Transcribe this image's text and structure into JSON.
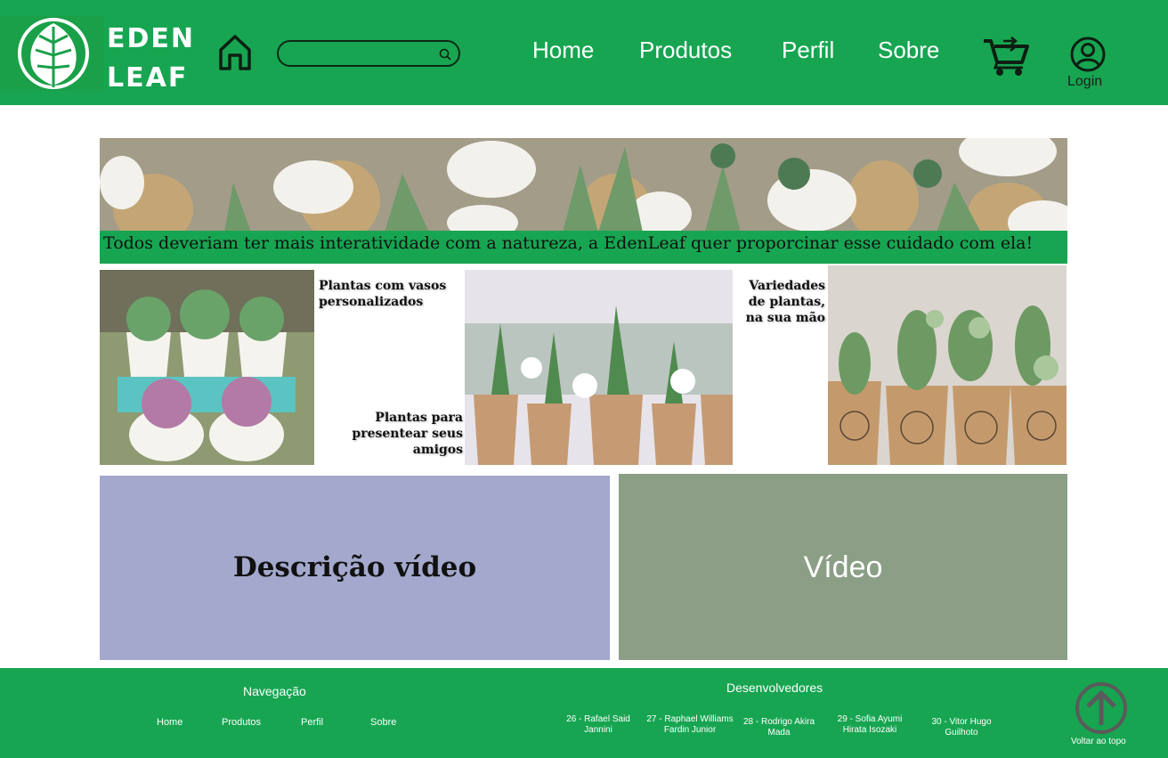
{
  "header": {
    "brand_line1": "EDEN",
    "brand_line2": "LEAF",
    "search": {
      "placeholder": "",
      "value": ""
    },
    "nav": [
      "Home",
      "Produtos",
      "Perfil",
      "Sobre"
    ],
    "login_label": "Login",
    "icons": [
      "leaf-logo",
      "home-icon",
      "search-icon",
      "cart-icon",
      "user-icon"
    ]
  },
  "banner": {
    "image": "succulents-with-cultive-o-amor-tags",
    "caption": "Todos deveriam ter mais interatividade com a natureza, a EdenLeaf quer proporcinar esse cuidado com ela!"
  },
  "gallery": {
    "caption1": "Plantas com vasos personalizados",
    "caption2": "Plantas para presentear seus amigos",
    "caption3": "Variedades de plantas, na sua mão"
  },
  "video_section": {
    "description_title": "Descrição vídeo",
    "video_label": "Vídeo"
  },
  "footer": {
    "nav_heading": "Navegação",
    "nav": [
      "Home",
      "Produtos",
      "Perfil",
      "Sobre"
    ],
    "dev_heading": "Desenvolvedores",
    "developers": [
      "26 - Rafael Said Jannini",
      "27 - Raphael Williams Fardin Junior",
      "28 - Rodrigo Akira Mada",
      "29 - Sofia Ayumi Hirata Isozaki",
      "30 - Vitor Hugo Guilhoto"
    ],
    "back_to_top": "Voltar ao topo"
  },
  "colors": {
    "brand_green": "#17a551",
    "description_box": "#a3a8cc",
    "video_box": "#8b9f87"
  }
}
